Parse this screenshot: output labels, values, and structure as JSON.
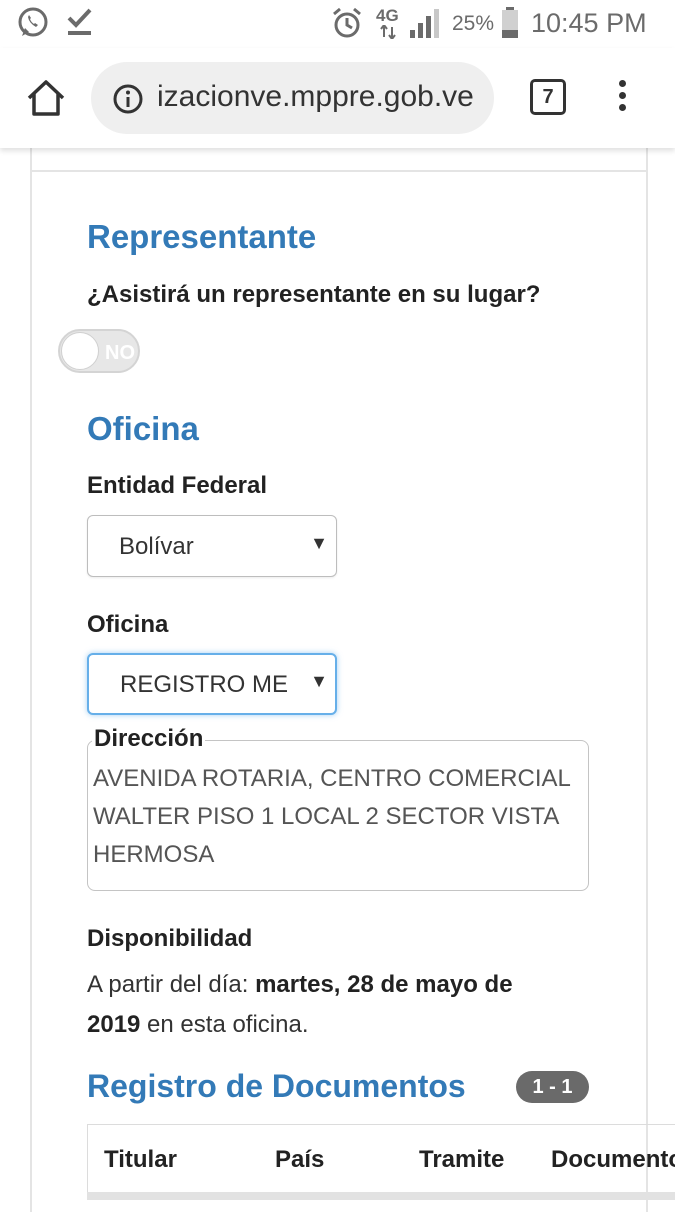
{
  "status_bar": {
    "battery_percent": "25%",
    "network": "4G",
    "time": "10:45 PM",
    "icons": [
      "whatsapp-icon",
      "download-done-icon",
      "alarm-icon",
      "signal-icon",
      "battery-icon"
    ]
  },
  "browser": {
    "url": "izacionve.mppre.gob.ve",
    "tab_count": "7"
  },
  "representante": {
    "title": "Representante",
    "question": "¿Asistirá un representante en su lugar?",
    "toggle_label": "NO"
  },
  "oficina": {
    "title": "Oficina",
    "entidad_label": "Entidad Federal",
    "entidad_value": "Bolívar",
    "oficina_label": "Oficina",
    "oficina_value": "REGISTRO ME",
    "direccion_label": "Dirección",
    "direccion_text": "AVENIDA ROTARIA, CENTRO COMERCIAL WALTER PISO 1 LOCAL 2 SECTOR VISTA HERMOSA",
    "disponibilidad_label": "Disponibilidad",
    "avail_prefix": "A partir del día: ",
    "avail_date": "martes, 28 de mayo de 2019",
    "avail_suffix": " en esta oficina."
  },
  "registro": {
    "title": "Registro de Documentos",
    "badge": "1 - 1",
    "columns": [
      "Titular",
      "País",
      "Tramite",
      "Documento"
    ]
  },
  "colors": {
    "accent": "#337ab7",
    "focus": "#66afe9"
  }
}
